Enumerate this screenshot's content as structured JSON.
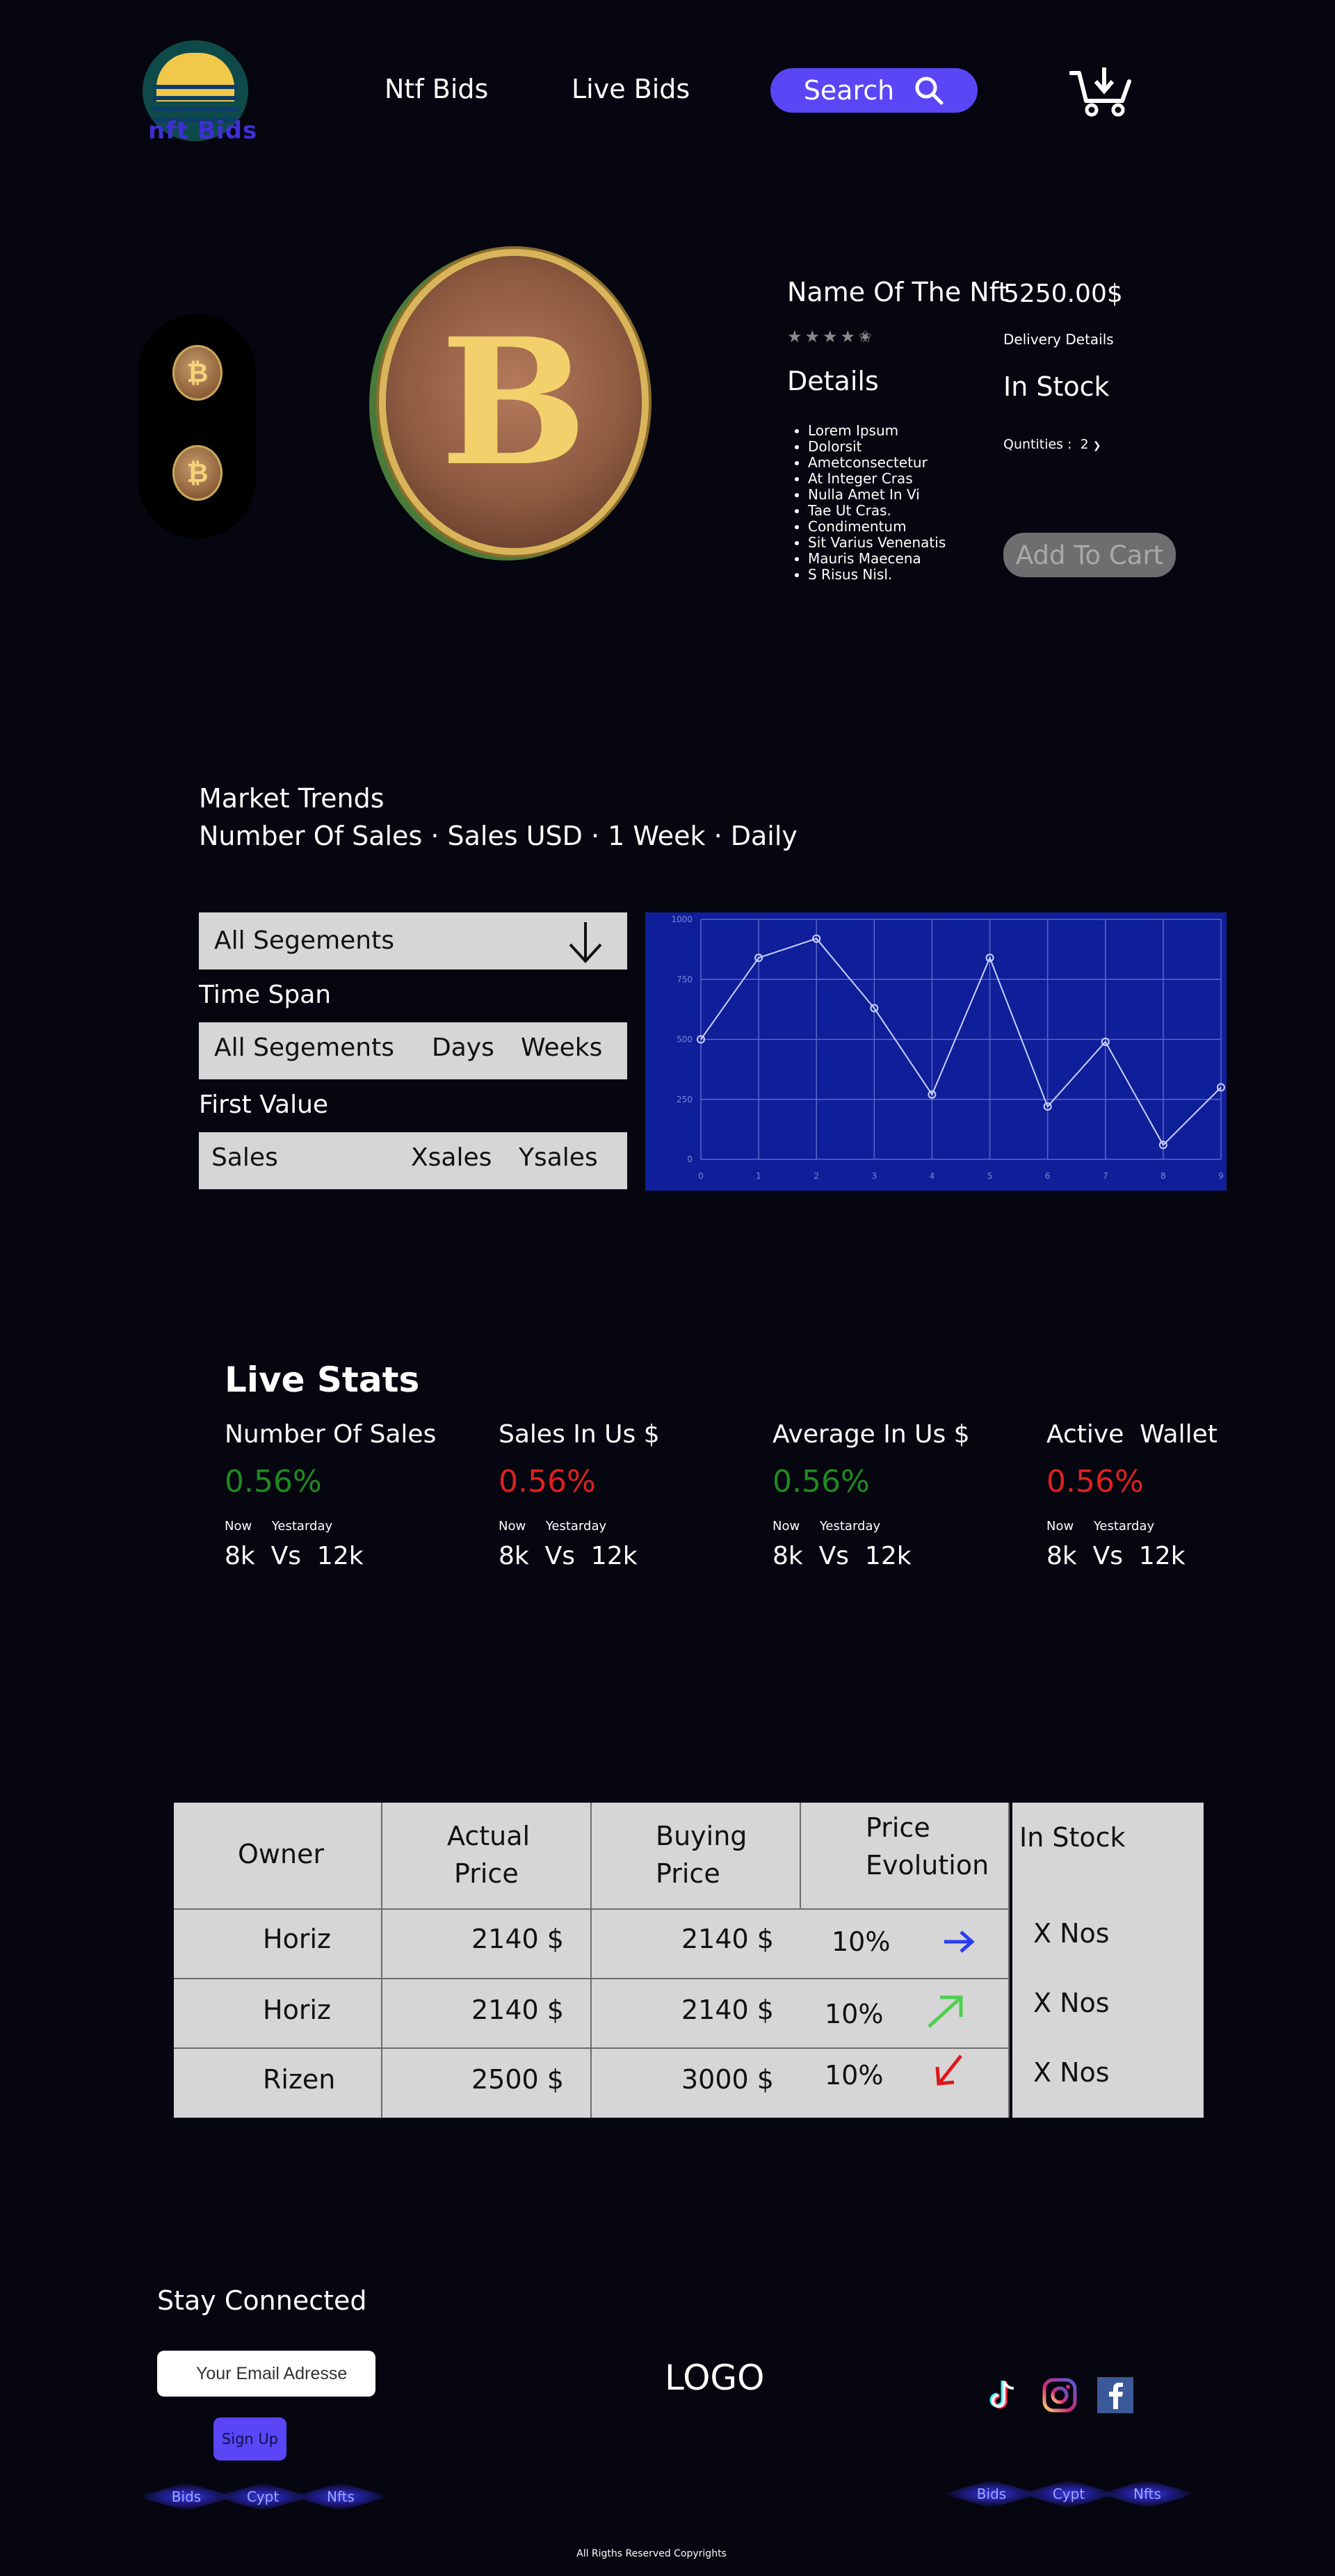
{
  "header": {
    "logo_text": "nft Bids",
    "nav": [
      "Ntf Bids",
      "Live Bids"
    ],
    "search_label": "Search"
  },
  "product": {
    "name": "Name Of The Nft",
    "price": "5250.00$",
    "rating": 4.5,
    "rating_max": 5,
    "delivery_label": "Delivery Details",
    "details_heading": "Details",
    "stock_status": "In Stock",
    "details": [
      "Lorem Ipsum",
      "Dolorsit",
      "Ametconsectetur",
      "At Integer Cras",
      "Nulla Amet In Vi",
      "Tae Ut Cras.",
      "Condimentum",
      "Sit Varius Venenatis",
      " Mauris Maecena",
      "S Risus Nisl."
    ],
    "quantity_label": "Quntities :",
    "quantity_value": "2",
    "add_to_cart": "Add To Cart"
  },
  "market": {
    "title": "Market Trends",
    "subtitle": "Number Of Sales · Sales USD · 1 Week · Daily",
    "segment_select": "All Segements",
    "time_span_label": "Time Span",
    "time_span_options": [
      "All Segements",
      "Days",
      "Weeks"
    ],
    "first_value_label": "First Value",
    "first_value_options": [
      "Sales",
      "Xsales",
      "Ysales"
    ]
  },
  "chart_data": {
    "type": "line",
    "x": [
      0,
      1,
      2,
      3,
      4,
      5,
      6,
      7,
      8,
      9
    ],
    "values": [
      500,
      840,
      920,
      630,
      270,
      840,
      220,
      490,
      60,
      300
    ],
    "ylim": [
      0,
      1000
    ],
    "yticks": [
      0,
      250,
      500,
      750,
      1000
    ],
    "grid": true,
    "colors": {
      "background": "#0f1f9a",
      "line": "#c9d0ff",
      "grid": "#5b67c8",
      "tick": "#7d86d6"
    }
  },
  "live_stats": {
    "title": "Live Stats",
    "items": [
      {
        "label": "Number Of Sales",
        "pct": "0.56%",
        "trend": "up",
        "now": "Now",
        "yesterday": "Yestarday",
        "vs": "8k  Vs  12k"
      },
      {
        "label": "Sales In Us $",
        "pct": "0.56%",
        "trend": "down",
        "now": "Now",
        "yesterday": "Yestarday",
        "vs": "8k  Vs  12k"
      },
      {
        "label": "Average In Us $",
        "pct": "0.56%",
        "trend": "up",
        "now": "Now",
        "yesterday": "Yestarday",
        "vs": "8k  Vs  12k"
      },
      {
        "label": "Active  Wallet",
        "pct": "0.56%",
        "trend": "down",
        "now": "Now",
        "yesterday": "Yestarday",
        "vs": "8k  Vs  12k"
      }
    ],
    "colors": {
      "up": "#1f8a1f",
      "down": "#e02020"
    }
  },
  "table": {
    "headers": {
      "owner": "Owner",
      "actual_1": "Actual",
      "actual_2": "Price",
      "buying_1": "Buying",
      "buying_2": "Price",
      "evolution_1": "Price",
      "evolution_2": "Evolution",
      "stock": "In Stock"
    },
    "rows": [
      {
        "owner": "Horiz",
        "actual": "2140 $",
        "buying": "2140 $",
        "evolution": "10%",
        "arrow": "right-arrow-icon",
        "arrow_color": "#2a3cf0",
        "stock": "X Nos"
      },
      {
        "owner": "Horiz",
        "actual": "2140 $",
        "buying": "2140 $",
        "evolution": "10%",
        "arrow": "up-right-arrow-icon",
        "arrow_color": "#4fcf4f",
        "stock": "X Nos"
      },
      {
        "owner": "Rizen",
        "actual": "2500 $",
        "buying": "3000 $",
        "evolution": "10%",
        "arrow": "down-left-arrow-icon",
        "arrow_color": "#e01818",
        "stock": "X Nos"
      }
    ]
  },
  "footer": {
    "stay_connected": "Stay Connected",
    "email_placeholder": "Your Email Adresse",
    "signup": "Sign Up",
    "logo": "LOGO",
    "left_links": [
      "Bids",
      "Cypt",
      "Nfts"
    ],
    "right_links": [
      "Bids",
      "Cypt",
      "Nfts"
    ],
    "social": [
      "tiktok-icon",
      "instagram-icon",
      "facebook-icon"
    ],
    "copyright": "All Rigths Reserved Copyrights"
  }
}
